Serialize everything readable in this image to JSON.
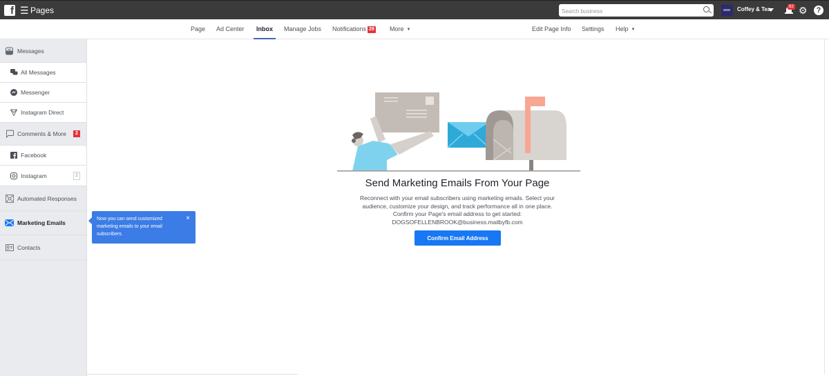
{
  "topbar": {
    "app_title": "Pages",
    "search_placeholder": "Search business",
    "page_name": "Coffey & Tea",
    "notifications_count": "82",
    "help_label": "?"
  },
  "page_nav": {
    "left_tabs": [
      {
        "label": "Page"
      },
      {
        "label": "Ad Center"
      },
      {
        "label": "Inbox",
        "active": true
      },
      {
        "label": "Manage Jobs"
      },
      {
        "label": "Notifications",
        "badge": "29"
      },
      {
        "label": "More"
      }
    ],
    "right_tabs": [
      {
        "label": "Edit Page Info"
      },
      {
        "label": "Settings"
      },
      {
        "label": "Help"
      }
    ]
  },
  "sidebar": {
    "items": [
      {
        "label": "Messages",
        "icon": "inbox-tray-icon"
      },
      {
        "label": "All Messages",
        "icon": "chat-bubbles-icon"
      },
      {
        "label": "Messenger",
        "icon": "messenger-icon"
      },
      {
        "label": "Instagram Direct",
        "icon": "instagram-direct-icon"
      },
      {
        "label": "Comments & More",
        "icon": "comment-icon",
        "badge": "2"
      },
      {
        "label": "Facebook",
        "icon": "facebook-icon"
      },
      {
        "label": "Instagram",
        "icon": "instagram-icon",
        "count": "2"
      },
      {
        "label": "Automated Responses",
        "icon": "automation-icon"
      },
      {
        "label": "Marketing Emails",
        "icon": "envelope-icon",
        "active": true
      },
      {
        "label": "Contacts",
        "icon": "contact-card-icon"
      }
    ]
  },
  "tooltip": {
    "text": "Now you can send customized marketing emails to your email subscribers.",
    "close": "×"
  },
  "main": {
    "headline": "Send Marketing Emails From Your Page",
    "description_1": "Reconnect with your email subscribers using marketing emails. Select your audience, customize your design, and track performance all in one place.",
    "description_2": "Confirm your Page's email address to get started:",
    "email": "DOGSOFELLENBROOK@business.mailbyfb.com",
    "confirm_button": "Confirm Email Address"
  },
  "colors": {
    "topbar": "#3b3b3b",
    "accent_blue": "#1877f2",
    "tooltip_blue": "#3b7ce6",
    "badge_red": "#e4333c",
    "sidebar_bg": "#e9ebee"
  }
}
